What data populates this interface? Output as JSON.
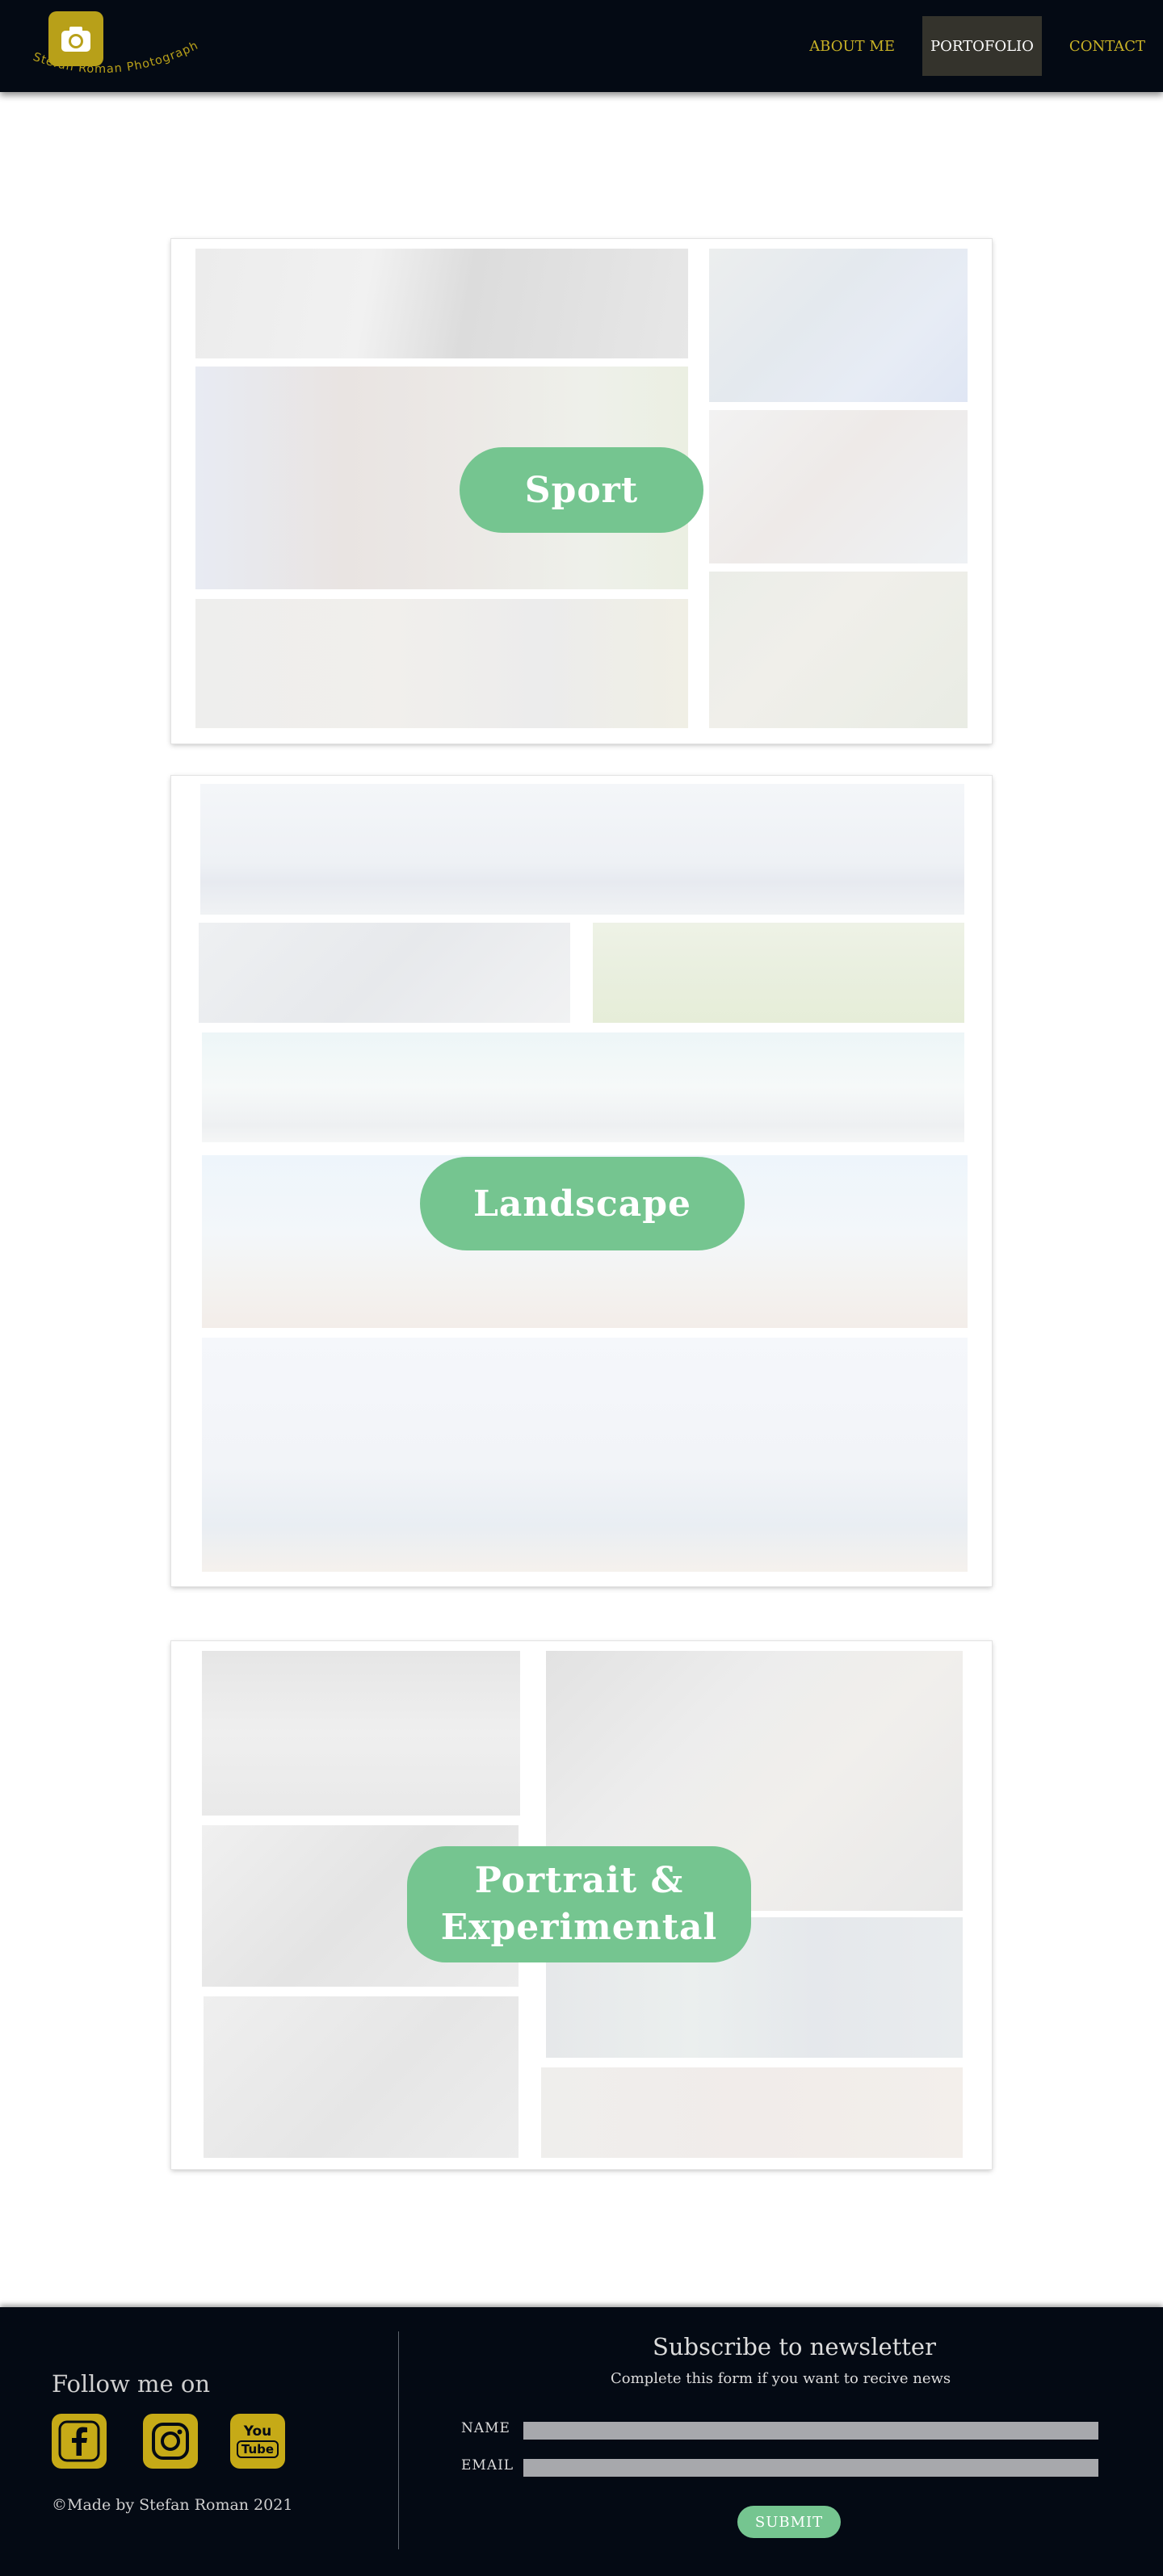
{
  "brand": {
    "logo_text": "Stefan Roman Photography",
    "accent_color": "#c6aa17"
  },
  "nav": {
    "items": [
      {
        "label": "ABOUT ME"
      },
      {
        "label": "PORTOFOLIO",
        "active": true
      },
      {
        "label": "CONTACT"
      }
    ]
  },
  "galleries": {
    "sport": {
      "label": "Sport"
    },
    "landscape": {
      "label": "Landscape"
    },
    "portrait": {
      "label_line1": "Portrait &",
      "label_line2": "Experimental"
    }
  },
  "footer": {
    "follow_title": "Follow me on",
    "social": [
      {
        "name": "facebook-icon"
      },
      {
        "name": "instagram-icon"
      },
      {
        "name": "youtube-icon",
        "text_top": "You",
        "text_bottom": "Tube"
      }
    ],
    "made_by": "©Made by Stefan Roman  2021",
    "newsletter": {
      "title": "Subscribe to newsletter",
      "subtitle": "Complete this form  if you want to recive news",
      "name_label": "NAME",
      "email_label": "EMAIL",
      "submit_label": "SUBMIT"
    }
  }
}
